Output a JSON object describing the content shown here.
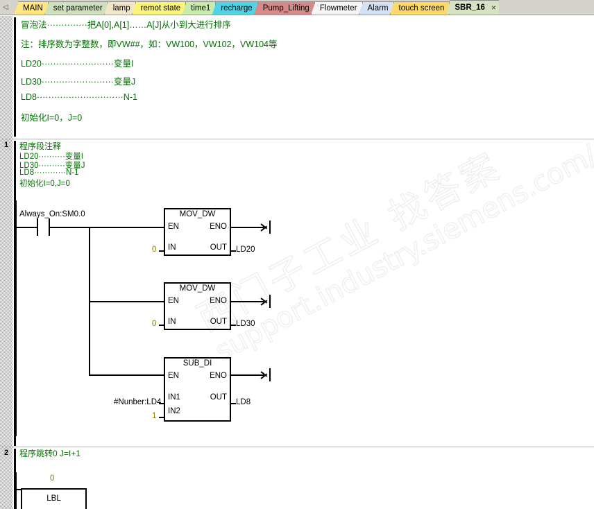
{
  "tabbar": {
    "scroll_left_icon": "triangle-left-icon",
    "tabs": [
      {
        "label": "MAIN",
        "color": "#ffe680",
        "active": false
      },
      {
        "label": "set parameter",
        "color": "#cfe0bd",
        "active": false
      },
      {
        "label": "lamp",
        "color": "#f2e6c9",
        "active": false
      },
      {
        "label": "remot state",
        "color": "#fbf47a",
        "active": false
      },
      {
        "label": "time1",
        "color": "#c8ecaa",
        "active": false
      },
      {
        "label": "recharge",
        "color": "#4fd4e6",
        "active": false
      },
      {
        "label": "Pump_Lifting",
        "color": "#d68a8a",
        "active": false
      },
      {
        "label": "Flowmeter",
        "color": "#f5f5f5",
        "active": false
      },
      {
        "label": "Alarm",
        "color": "#d5e2f5",
        "active": false
      },
      {
        "label": "touch screen",
        "color": "#fdd96a",
        "active": false
      },
      {
        "label": "SBR_16",
        "color": "#d7e2c4",
        "active": true
      }
    ],
    "close_label": "×"
  },
  "editor": {
    "networks": [
      {
        "number": "",
        "comment_lines": [
          "冒泡法··············把A[0],A[1]……A[J]从小到大进行排序",
          "注：排序数为字整数，即VW##，如：VW100，VW102，VW104等",
          "LD20·························变量I",
          "LD30·························变量J",
          "LD8······························N-1",
          "初始化I=0，J=0"
        ]
      },
      {
        "number": "1",
        "comment_lines": [
          "程序段注释",
          "LD20··········变量I",
          "LD30··········变量J",
          "LD8············N-1",
          "初始化I=0,J=0"
        ],
        "contact": {
          "label": "Always_On:SM0.0",
          "type": "normally-open"
        },
        "blocks": [
          {
            "title": "MOV_DW",
            "pin_en": "EN",
            "pin_eno": "ENO",
            "pin_in": "IN",
            "pin_out": "OUT",
            "in_value": "0",
            "out_value": "LD20"
          },
          {
            "title": "MOV_DW",
            "pin_en": "EN",
            "pin_eno": "ENO",
            "pin_in": "IN",
            "pin_out": "OUT",
            "in_value": "0",
            "out_value": "LD30"
          },
          {
            "title": "SUB_DI",
            "pin_en": "EN",
            "pin_eno": "ENO",
            "pin_in1": "IN1",
            "pin_in2": "IN2",
            "pin_out": "OUT",
            "in1_value": "#Nunber:LD4",
            "in2_value": "1",
            "out_value": "LD8"
          }
        ]
      },
      {
        "number": "2",
        "comment_lines": [
          "程序跳转0 J=I+1"
        ],
        "lbl": {
          "label_number": "0",
          "box_title": "LBL"
        }
      }
    ]
  },
  "watermark": {
    "chinese": "西门子工业  找答案",
    "url": "support.industry.siemens.com/cs"
  },
  "colors": {
    "comment_green": "#007000",
    "constant_olive": "#8a7a00",
    "tabbar_bg": "#d6d3ce"
  }
}
